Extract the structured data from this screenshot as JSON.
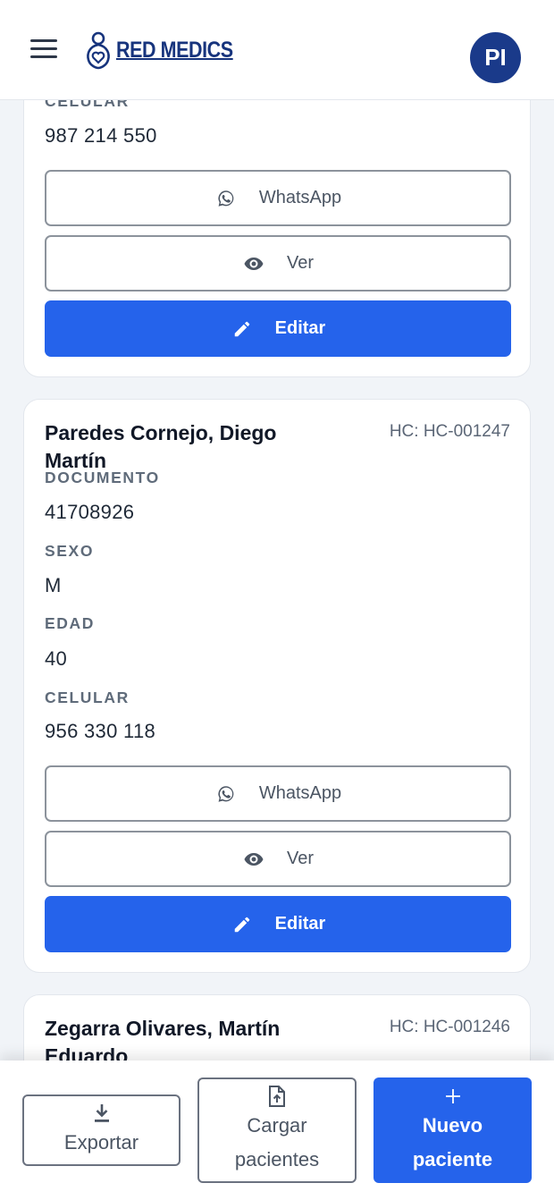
{
  "header": {
    "brand": "RED MEDICS",
    "avatar_initials": "PI"
  },
  "field_labels": {
    "document": "DOCUMENTO",
    "sex": "SEXO",
    "age": "EDAD",
    "phone": "CELULAR"
  },
  "actions": {
    "whatsapp": "WhatsApp",
    "view": "Ver",
    "edit": "Editar"
  },
  "patients": [
    {
      "phone": "987 214 550"
    },
    {
      "name": "Paredes Cornejo, Diego Martín",
      "hc": "HC: HC-001247",
      "document": "41708926",
      "sex": "M",
      "age": "40",
      "phone": "956 330 118"
    },
    {
      "name": "Zegarra Olivares, Martín Eduardo",
      "hc": "HC: HC-001246"
    }
  ],
  "bottom_bar": {
    "export": "Exportar",
    "upload_line1": "Cargar",
    "upload_line2": "pacientes",
    "new_line1": "Nuevo",
    "new_line2": "paciente"
  },
  "colors": {
    "primary": "#2563eb",
    "brand": "#17347d",
    "avatar_bg": "#1a3a8a",
    "background": "#f1f4f8"
  },
  "icons": [
    "menu-icon",
    "logo-icon",
    "whatsapp-icon",
    "eye-icon",
    "pencil-icon",
    "download-icon",
    "file-upload-icon",
    "plus-icon"
  ]
}
